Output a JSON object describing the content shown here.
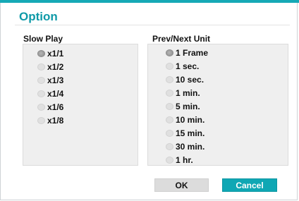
{
  "dialog": {
    "title": "Option"
  },
  "slow_play": {
    "label": "Slow Play",
    "options": [
      "x1/1",
      "x1/2",
      "x1/3",
      "x1/4",
      "x1/6",
      "x1/8"
    ],
    "selected": "x1/1"
  },
  "unit": {
    "label": "Prev/Next Unit",
    "options": [
      "1 Frame",
      "1 sec.",
      "10 sec.",
      "1 min.",
      "5 min.",
      "10 min.",
      "15 min.",
      "30 min.",
      "1 hr."
    ],
    "selected": "1 Frame"
  },
  "buttons": {
    "ok": "OK",
    "cancel": "Cancel"
  },
  "colors": {
    "accent": "#16a9b6",
    "cancel_bg": "#0fa7b4",
    "ok_bg": "#dcdcdc",
    "panel_bg": "#efefef"
  }
}
